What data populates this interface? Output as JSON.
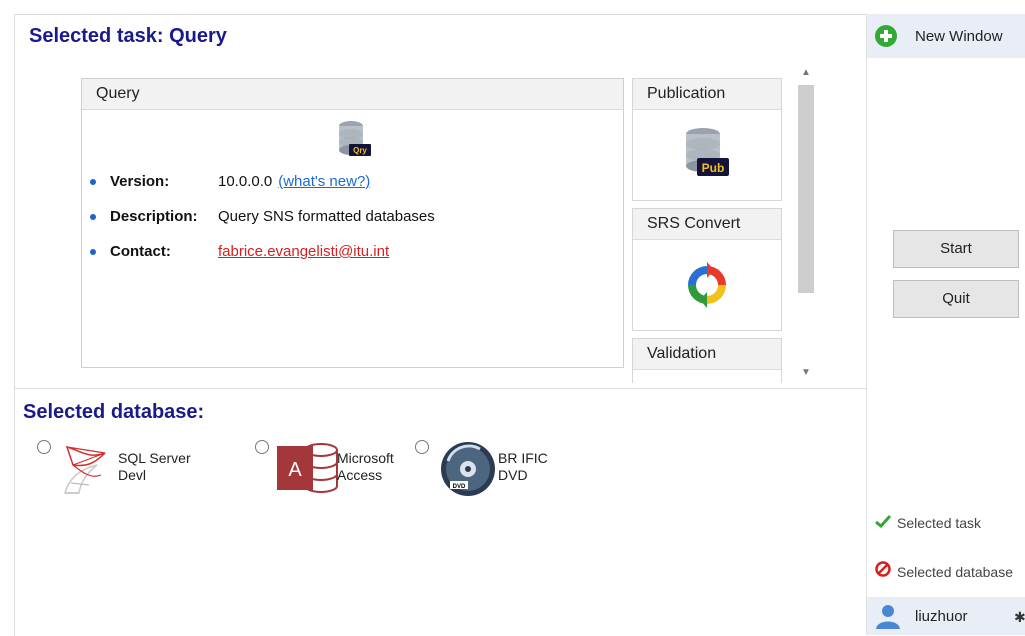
{
  "task": {
    "title": "Selected task: Query",
    "panel_title": "Query",
    "icon_label": "Qry",
    "version_label": "Version:",
    "version_value": "10.0.0.0",
    "whats_new": "(what's new?)",
    "description_label": "Description:",
    "description_value": "Query SNS formatted databases",
    "contact_label": "Contact:",
    "contact_value": "fabrice.evangelisti@itu.int"
  },
  "side_tasks": [
    {
      "label": "Publication",
      "icon_label": "Pub"
    },
    {
      "label": "SRS Convert"
    },
    {
      "label": "Validation"
    }
  ],
  "database": {
    "title": "Selected database:",
    "options": [
      {
        "label": "SQL Server\nDevl"
      },
      {
        "label": "Microsoft\nAccess"
      },
      {
        "label": "BR IFIC\nDVD"
      }
    ]
  },
  "right_panel": {
    "new_window": "New Window",
    "start": "Start",
    "quit": "Quit",
    "status_task": "Selected task",
    "status_database": "Selected database",
    "user": "liuzhuor"
  },
  "colors": {
    "accent_title": "#1a1a8c",
    "link": "#1a6bd6",
    "email": "#d82020",
    "ok": "#3aa335",
    "error": "#d81f1f"
  }
}
